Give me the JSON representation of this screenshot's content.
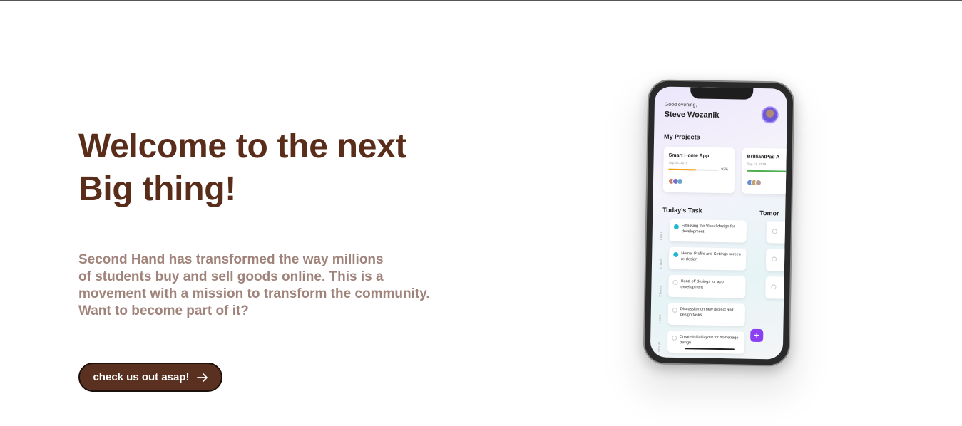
{
  "hero": {
    "title_lines": [
      "Welcome to the next",
      "Big thing!"
    ],
    "description_lines": [
      "Second Hand has transformed the way millions",
      "of students buy and sell goods online. This is a",
      "movement with a mission to transform the community.",
      "Want to become part of it?"
    ],
    "cta_label": "check us out asap!",
    "cta_icon": "arrow-right-icon"
  },
  "colors": {
    "title": "#5a2d1a",
    "description": "#a0837a",
    "cta_background": "#5a3121",
    "accent_purple": "#8b3ff0",
    "check_teal": "#22b8cf"
  },
  "phone_app": {
    "greeting": "Good evening,",
    "user_name": "Steve Wozanik",
    "my_projects_title": "My Projects",
    "projects": [
      {
        "name": "Smart Home App",
        "date": "Sep 12, 2019",
        "progress_pct": "92%",
        "progress": 0.55,
        "color": "#f59e0b"
      },
      {
        "name": "BrilliantPad A",
        "date": "Sep 12, 2019",
        "progress_pct": "",
        "progress": 1.0,
        "color": "#4caf50"
      }
    ],
    "todays_task_title": "Today's Task",
    "tomorrow_title": "Tomor",
    "hour_labels": [
      "1 hour",
      "2 hours",
      "2 hours",
      "1 hour",
      "2 hours"
    ],
    "tasks": [
      {
        "text": "Finalising the Visual design for development",
        "done": true
      },
      {
        "text": "Home, Profile and Settings screen re-design",
        "done": true
      },
      {
        "text": "Hand-off desings for app development",
        "done": false
      },
      {
        "text": "Discussion on new project and design tasks",
        "done": false
      },
      {
        "text": "Create initial layout for homepage design",
        "done": false
      }
    ],
    "fab_label": "+"
  }
}
